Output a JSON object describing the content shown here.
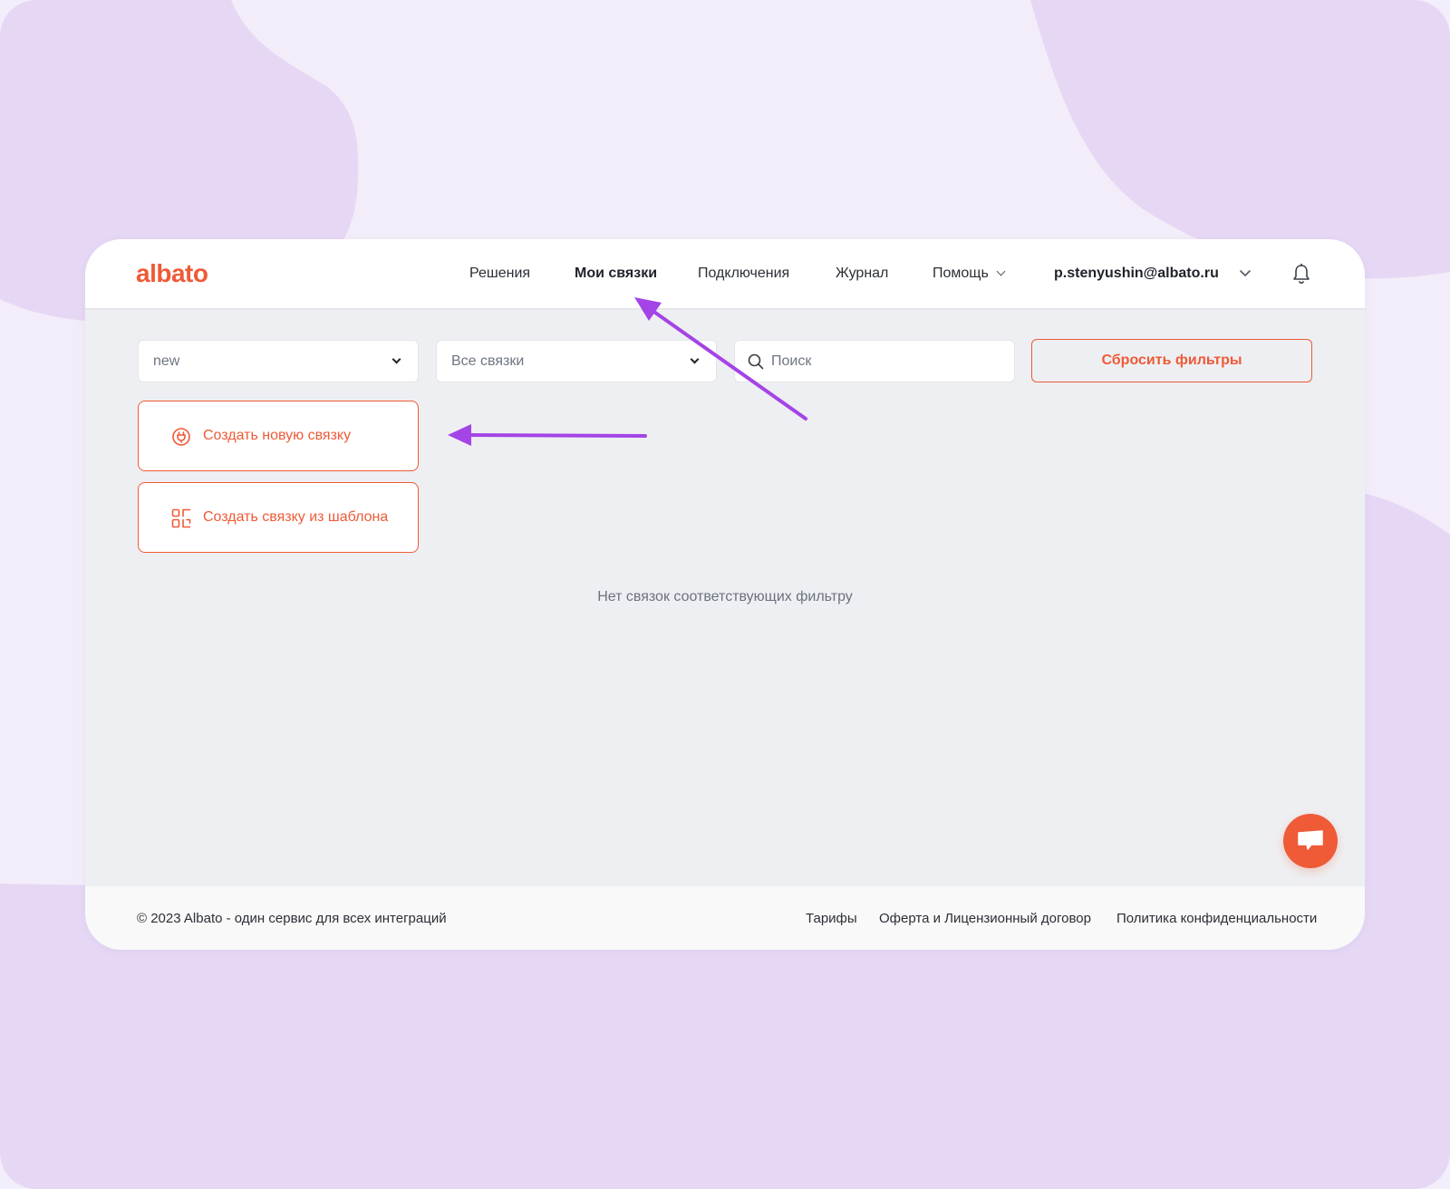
{
  "app": {
    "logo_text": "albato"
  },
  "nav": {
    "items": [
      {
        "label": "Решения",
        "active": false
      },
      {
        "label": "Мои связки",
        "active": true
      },
      {
        "label": "Подключения",
        "active": false
      },
      {
        "label": "Журнал",
        "active": false
      },
      {
        "label": "Помощь",
        "active": false
      }
    ],
    "user_email": "p.stenyushin@albato.ru"
  },
  "filters": {
    "folder_select": "new",
    "status_select": "Все связки",
    "search_placeholder": "Поиск",
    "reset_label": "Сбросить фильтры"
  },
  "actions": {
    "create_new_label": "Создать новую связку",
    "create_from_template_label": "Создать связку из шаблона"
  },
  "empty_message": "Нет связок соответствующих фильтру",
  "footer": {
    "copyright": "© 2023 Albato - один сервис для всех интеграций",
    "links": [
      "Тарифы",
      "Оферта и Лицензионный договор",
      "Политика конфиденциальности"
    ]
  },
  "colors": {
    "accent": "#ef5a37",
    "annotation_arrow": "#a444e6",
    "background_blob": "#e6d8f5"
  },
  "icons": [
    "bell-icon",
    "search-icon",
    "chevron-down-icon",
    "plug-icon",
    "template-icon",
    "chat-icon"
  ]
}
